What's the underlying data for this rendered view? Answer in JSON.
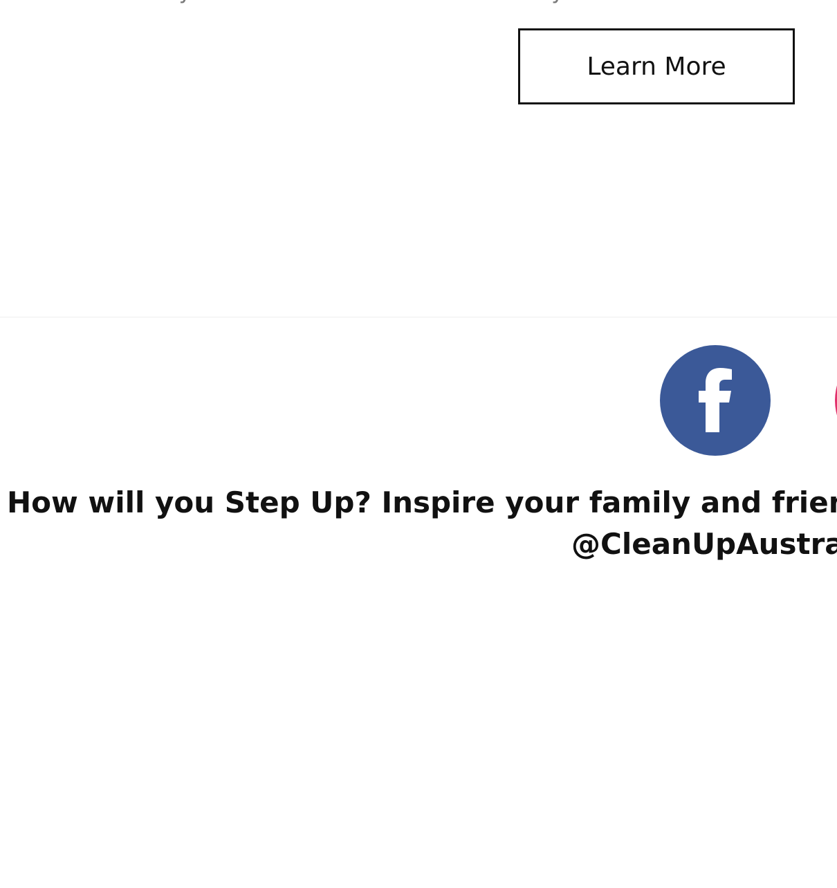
{
  "top": {
    "left_fragment": "o material we recycle.",
    "right_fragment": "recycled."
  },
  "learn_more": {
    "label": "Learn More"
  },
  "social": {
    "facebook_icon": "facebook-icon",
    "instagram_icon": "instagram-icon",
    "facebook_color": "#3b5998",
    "instagram_color": "#e1306c"
  },
  "cta": {
    "line1": "How will you Step Up? Inspire your family and friends",
    "line2": "@CleanUpAustralia"
  }
}
